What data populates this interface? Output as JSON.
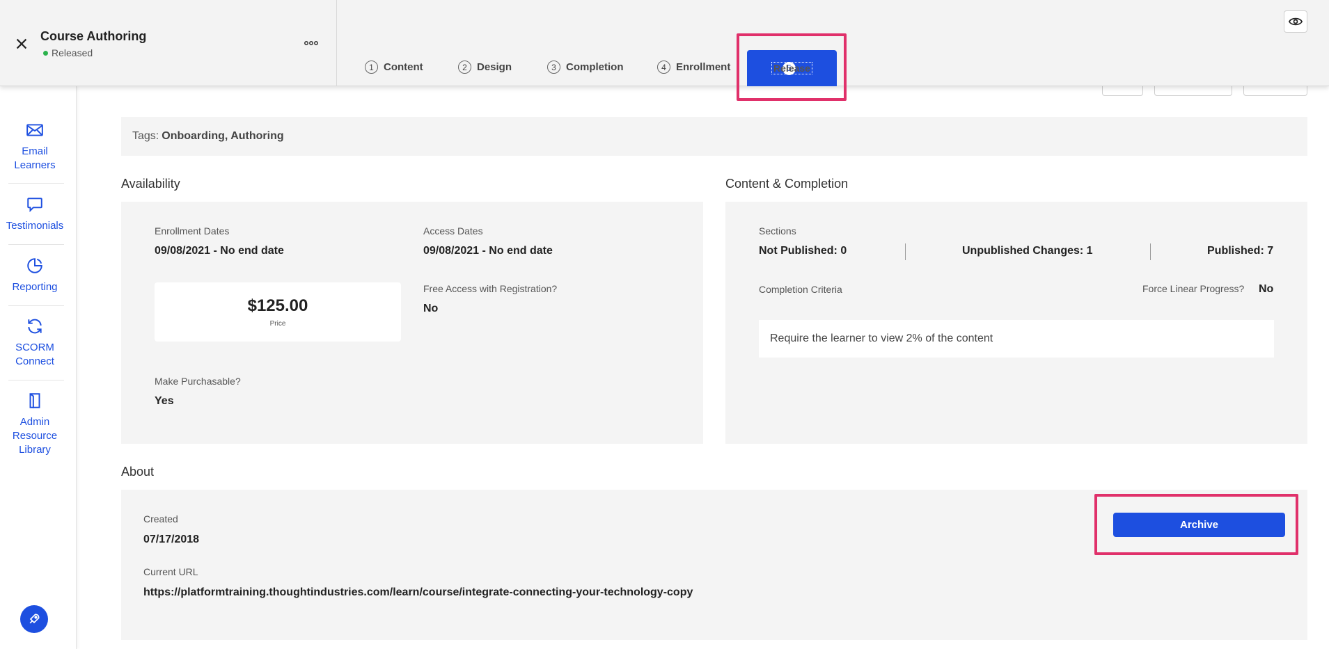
{
  "header": {
    "title": "Course Authoring",
    "status": "Released",
    "tabs": [
      {
        "num": "1",
        "label": "Content"
      },
      {
        "num": "2",
        "label": "Design"
      },
      {
        "num": "3",
        "label": "Completion"
      },
      {
        "num": "4",
        "label": "Enrollment"
      },
      {
        "num": "5",
        "label": "Release"
      }
    ],
    "active_tab": "Release"
  },
  "sidebar": {
    "items": [
      {
        "label": "Email Learners",
        "icon": "mail-icon"
      },
      {
        "label": "Testimonials",
        "icon": "speech-bubble-icon"
      },
      {
        "label": "Reporting",
        "icon": "pie-chart-icon"
      },
      {
        "label": "SCORM Connect",
        "icon": "sync-icon"
      },
      {
        "label": "Admin Resource Library",
        "icon": "book-icon"
      }
    ],
    "fab_icon": "rocket-icon"
  },
  "tags": {
    "prefix": "Tags:",
    "values": "Onboarding, Authoring"
  },
  "availability": {
    "title": "Availability",
    "enrollment_dates_label": "Enrollment Dates",
    "enrollment_dates_value": "09/08/2021 - No end date",
    "access_dates_label": "Access Dates",
    "access_dates_value": "09/08/2021 - No end date",
    "price_amount": "$125.00",
    "price_label": "Price",
    "free_access_label": "Free Access with Registration?",
    "free_access_value": "No",
    "purchasable_label": "Make Purchasable?",
    "purchasable_value": "Yes"
  },
  "content_completion": {
    "title": "Content & Completion",
    "sections_label": "Sections",
    "not_published": "Not Published: 0",
    "unpublished_changes": "Unpublished Changes: 1",
    "published": "Published: 7",
    "criteria_label": "Completion Criteria",
    "force_linear_label": "Force Linear Progress?",
    "force_linear_value": "No",
    "criteria_text": "Require the learner to view 2% of the content"
  },
  "about": {
    "title": "About",
    "created_label": "Created",
    "created_value": "07/17/2018",
    "url_label": "Current URL",
    "url_value": "https://platformtraining.thoughtindustries.com/learn/course/integrate-connecting-your-technology-copy",
    "archive_label": "Archive"
  },
  "colors": {
    "accent": "#1d4fe0",
    "highlight": "#e0306a",
    "status_green": "#2bb24c",
    "panel_bg": "#f4f4f4"
  }
}
